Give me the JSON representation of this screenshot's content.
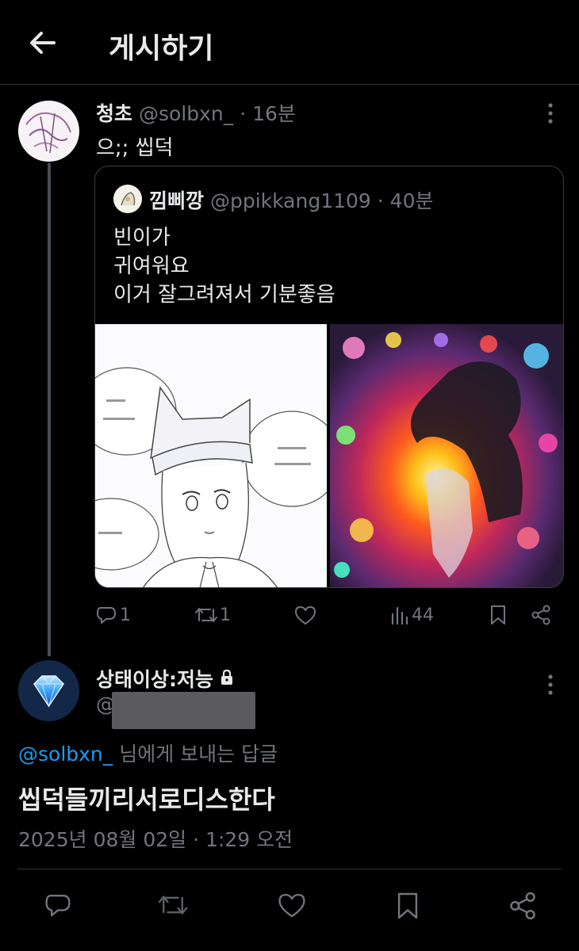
{
  "header": {
    "title": "게시하기"
  },
  "tweet": {
    "display_name": "청초",
    "handle": "@solbxn_",
    "time": "· 16분",
    "text": "으;; 씹덕",
    "quote": {
      "display_name": "낌삐깡",
      "handle": "@ppikkang1109",
      "time": "· 40분",
      "lines": [
        "빈이가",
        "귀여워요",
        "이거 잘그려져서 기분좋음"
      ]
    },
    "actions": {
      "replies": "1",
      "retweets": "1",
      "views": "44"
    }
  },
  "reply": {
    "display_name": "상태이상:저능",
    "handle_prefix": "@",
    "reply_to_handle": "@solbxn_",
    "reply_to_suffix": " 님에게 보내는 답글",
    "text": "씹덕들끼리서로디스한다",
    "timestamp": "2025년 08월 02일 · 1:29 오전"
  },
  "colors": {
    "background": "#000000",
    "text": "#e7e9ea",
    "muted": "#71767b",
    "link": "#1d9bf0"
  },
  "icons": [
    "back-arrow-icon",
    "more-icon",
    "reply-icon",
    "retweet-icon",
    "like-icon",
    "views-icon",
    "bookmark-icon",
    "share-icon",
    "lock-icon"
  ]
}
